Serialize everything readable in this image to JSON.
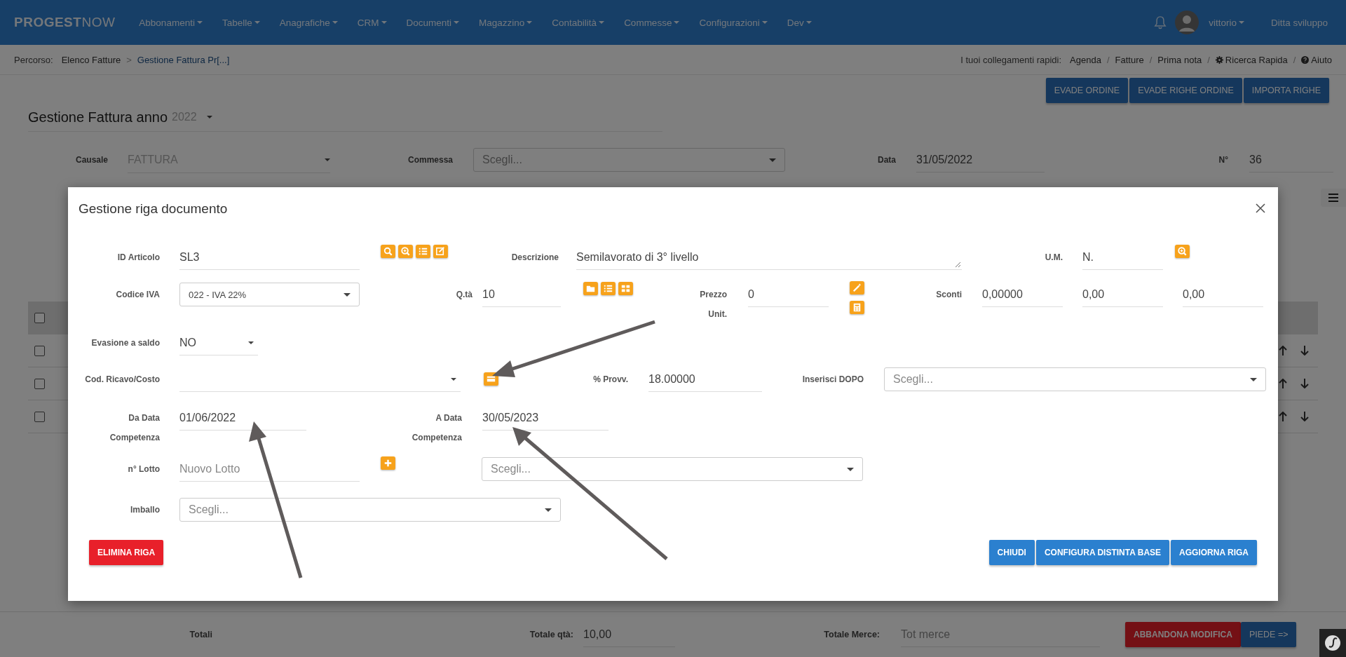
{
  "navbar": {
    "brand": "**PROGEST**NOW",
    "menu": [
      {
        "label": "Abbonamenti"
      },
      {
        "label": "Tabelle"
      },
      {
        "label": "Anagrafiche"
      },
      {
        "label": "CRM"
      },
      {
        "label": "Documenti"
      },
      {
        "label": "Magazzino"
      },
      {
        "label": "Contabilità"
      },
      {
        "label": "Commesse"
      },
      {
        "label": "Configurazioni"
      },
      {
        "label": "Dev"
      }
    ],
    "user": "vittorio",
    "company": "Ditta sviluppo"
  },
  "breadcrumb": {
    "label": "Percorso:",
    "separator": ">",
    "items": [
      "Elenco Fatture",
      "Gestione Fattura Pr[...]"
    ]
  },
  "quick_links": {
    "label": "I tuoi collegamenti rapidi:",
    "separator": "/",
    "items": [
      {
        "label": "Agenda",
        "kind": "plain"
      },
      {
        "label": "Fatture",
        "kind": "plain"
      },
      {
        "label": "Prima nota",
        "kind": "plain"
      },
      {
        "label": "Ricerca Rapida",
        "kind": "search"
      },
      {
        "label": "Aiuto",
        "kind": "help"
      }
    ]
  },
  "actions": [
    "EVADE ORDINE",
    "EVADE RIGHE ORDINE",
    "IMPORTA RIGHE"
  ],
  "page_title": {
    "text": "Gestione Fattura anno",
    "year": "2022"
  },
  "header_form": {
    "causale_label": "Causale",
    "causale": "FATTURA",
    "commessa_label": "Commessa",
    "commessa_placeholder": "Scegli...",
    "data_label": "Data",
    "data": "31/05/2022",
    "numero_label": "N°",
    "numero": "36"
  },
  "table": {
    "header_checked": false,
    "rows": [
      {
        "checked": false
      },
      {
        "checked": false
      },
      {
        "checked": false
      }
    ]
  },
  "modal": {
    "title": "Gestione riga documento",
    "id_articolo_label": "ID Articolo",
    "id_articolo": "SL3",
    "descrizione_label": "Descrizione",
    "descrizione": "Semilavorato di 3° livello",
    "um_label": "U.M.",
    "um": "N.",
    "codice_iva_label": "Codice IVA",
    "codice_iva": "022 - IVA 22%",
    "qta_label": "Q.tà",
    "qta": "10",
    "prezzo_label": "Prezzo",
    "prezzo_label_2": "Unit.",
    "prezzo": "0",
    "sconti_label": "Sconti",
    "sconti": [
      "0,00000",
      "0,00",
      "0,00"
    ],
    "evasione_label": "Evasione a saldo",
    "evasione": "NO",
    "ricavo_label": "Cod. Ricavo/Costo",
    "provv_label": "% Provv.",
    "provv": "18.00000",
    "inserisci_label": "Inserisci DOPO",
    "inserisci_placeholder": "Scegli...",
    "da_data_label": "Da Data",
    "da_data_label_2": "Competenza",
    "da_data": "01/06/2022",
    "a_data_label": "A Data",
    "a_data_label_2": "Competenza",
    "a_data": "30/05/2023",
    "lotto_label": "n° Lotto",
    "lotto_placeholder": "Nuovo Lotto",
    "lotto_select_placeholder": "Scegli...",
    "imballo_label": "Imballo",
    "imballo_placeholder": "Scegli...",
    "delete_button": "ELIMINA RIGA",
    "buttons": [
      "CHIUDI",
      "CONFIGURA DISTINTA BASE",
      "AGGIORNA RIGA"
    ]
  },
  "totals": {
    "label": "Totali",
    "qta_label": "Totale qtà:",
    "qta": "10,00",
    "merce_label": "Totale Merce:",
    "merce_placeholder": "Tot merce",
    "abandon_button": "ABBANDONA MODIFICA",
    "next_button": "PIEDE =>"
  }
}
